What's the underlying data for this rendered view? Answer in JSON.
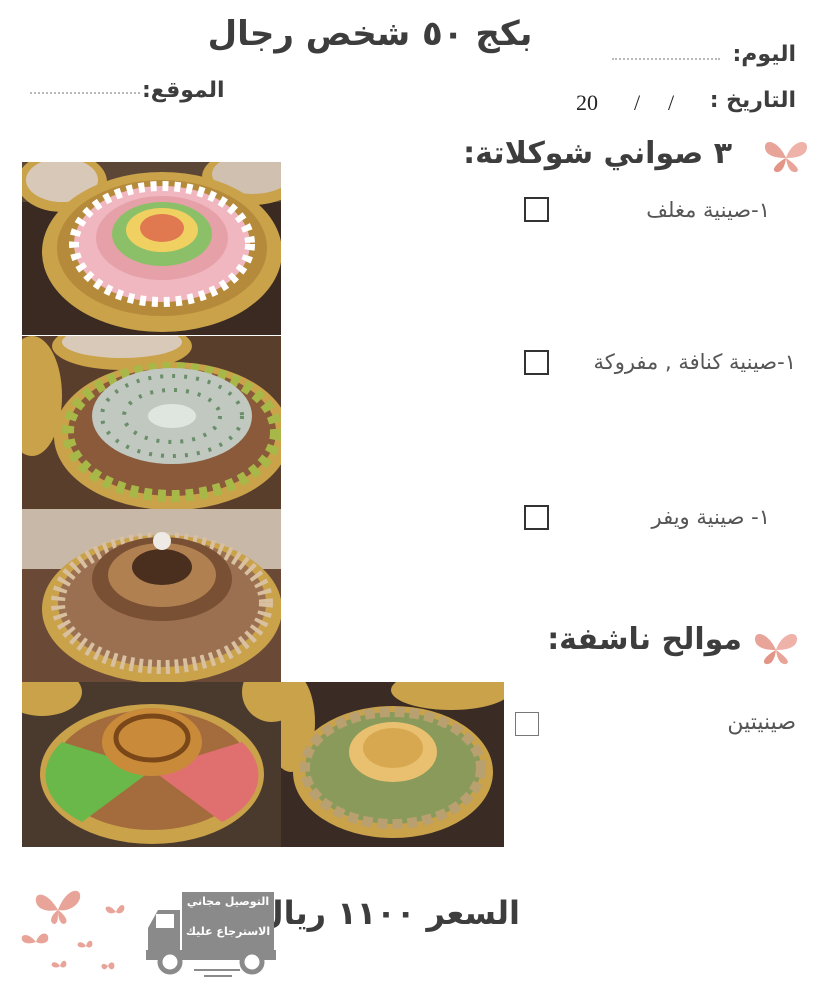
{
  "header": {
    "title": "بكج ٥٠ شخص رجال",
    "day_label": "اليوم:",
    "location_label": "الموقع:",
    "date_label": "التاريخ :",
    "date_year": "20",
    "date_separator": "/"
  },
  "sections": [
    {
      "title": "٣ صواني شوكلاتة:",
      "items": [
        {
          "label": "١-صينية مغلف"
        },
        {
          "label": "١-صينية كنافة , مفروكة"
        },
        {
          "label": "١- صينية ويفر"
        }
      ]
    },
    {
      "title": "موالح ناشفة:",
      "items": [
        {
          "label": "صينيتين"
        }
      ]
    }
  ],
  "footer": {
    "price": "السعر ١١٠٠ ريال",
    "truck_line1": "التوصيل مجاني",
    "truck_line2": "الاسترجاع عليك"
  },
  "colors": {
    "butterfly": "#e9a49a",
    "text": "#3d3d3d",
    "truck": "#8a8a8a"
  },
  "icons": [
    "butterfly-icon",
    "checkbox-icon",
    "delivery-truck-icon"
  ]
}
